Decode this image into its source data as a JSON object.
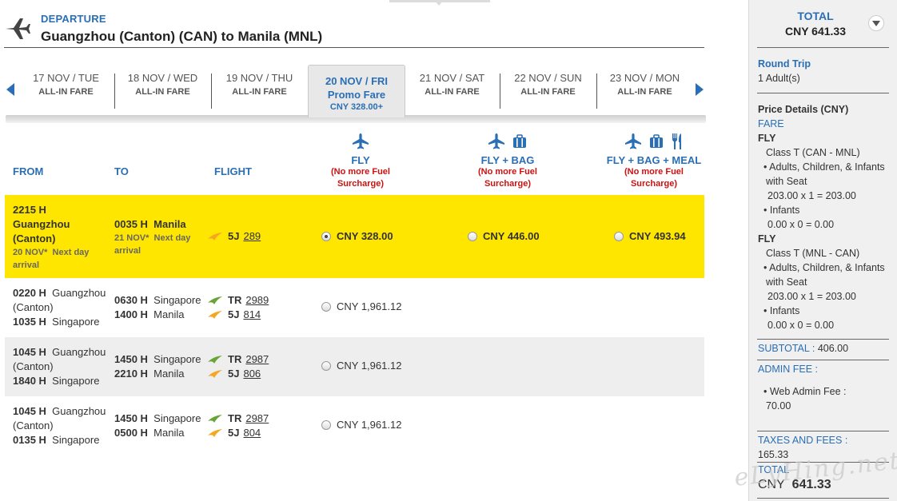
{
  "departure": {
    "label": "DEPARTURE",
    "route": "Guangzhou (Canton)  (CAN) to  Manila  (MNL)"
  },
  "dates": [
    {
      "date": "17 NOV / TUE",
      "fare": "ALL-IN FARE"
    },
    {
      "date": "18 NOV / WED",
      "fare": "ALL-IN FARE"
    },
    {
      "date": "19 NOV / THU",
      "fare": "ALL-IN FARE"
    },
    {
      "date": "20 NOV / FRI",
      "promo": "Promo Fare",
      "price": "CNY 328.00+"
    },
    {
      "date": "21 NOV / SAT",
      "fare": "ALL-IN FARE"
    },
    {
      "date": "22 NOV / SUN",
      "fare": "ALL-IN FARE"
    },
    {
      "date": "23 NOV / MON",
      "fare": "ALL-IN FARE"
    }
  ],
  "columns": {
    "from": "FROM",
    "to": "TO",
    "flight": "FLIGHT"
  },
  "fares": [
    {
      "name": "FLY",
      "note1": "(No more Fuel",
      "note2": "Surcharge)"
    },
    {
      "name": "FLY + BAG",
      "note1": "(No more Fuel",
      "note2": "Surcharge)"
    },
    {
      "name": "FLY + BAG + MEAL",
      "note1": "(No more Fuel",
      "note2": "Surcharge)"
    }
  ],
  "rows": [
    {
      "from": {
        "time": "2215 H",
        "place1": "Guangzhou",
        "place2": "(Canton)",
        "note": "20 NOV*",
        "note2": "Next day",
        "note3": "arrival"
      },
      "to": {
        "time": "0035 H",
        "place": "Manila",
        "note": "21 NOV*",
        "note2": "Next day",
        "note3": "arrival"
      },
      "flights": [
        {
          "code": "5J",
          "num": "289"
        }
      ],
      "prices": [
        "CNY 328.00",
        "CNY 446.00",
        "CNY 493.94"
      ]
    },
    {
      "from": {
        "time1": "0220 H",
        "place1": "Guangzhou",
        "place1b": "(Canton)",
        "time2": "1035 H",
        "place2": "Singapore"
      },
      "to": {
        "time1": "0630 H",
        "place1": "Singapore",
        "time2": "1400 H",
        "place2": "Manila"
      },
      "flights": [
        {
          "code": "TR",
          "num": "2989"
        },
        {
          "code": "5J",
          "num": "814"
        }
      ],
      "prices": [
        "CNY 1,961.12"
      ]
    },
    {
      "from": {
        "time1": "1045 H",
        "place1": "Guangzhou",
        "place1b": "(Canton)",
        "time2": "1840 H",
        "place2": "Singapore"
      },
      "to": {
        "time1": "1450 H",
        "place1": "Singapore",
        "time2": "2210 H",
        "place2": "Manila"
      },
      "flights": [
        {
          "code": "TR",
          "num": "2987"
        },
        {
          "code": "5J",
          "num": "806"
        }
      ],
      "prices": [
        "CNY 1,961.12"
      ]
    },
    {
      "from": {
        "time1": "1045 H",
        "place1": "Guangzhou",
        "place1b": "(Canton)",
        "time2": "0135 H",
        "place2": "Singapore"
      },
      "to": {
        "time1": "1450 H",
        "place1": "Singapore",
        "time2": "0500 H",
        "place2": "Manila"
      },
      "flights": [
        {
          "code": "TR",
          "num": "2987"
        },
        {
          "code": "5J",
          "num": "804"
        }
      ],
      "prices": [
        "CNY 1,961.12"
      ]
    }
  ],
  "sidebar": {
    "title": "TOTAL",
    "total": "CNY  641.33",
    "trip": "Round Trip",
    "pax": "1  Adult(s)",
    "price_details": "Price Details (CNY)",
    "fare_label": "FARE",
    "fly1": "FLY",
    "class1": "Class T (CAN - MNL)",
    "adults1a": "• Adults, Children, & Infants",
    "adults1b": "with Seat",
    "calc1": "203.00 x 1 = 203.00",
    "infants1": "• Infants",
    "calc1b": "0.00 x 0 = 0.00",
    "fly2": "FLY",
    "class2": "Class T (MNL - CAN)",
    "adults2a": "• Adults, Children, & Infants",
    "adults2b": "with Seat",
    "calc2": "203.00 x 1 = 203.00",
    "infants2": "• Infants",
    "calc2b": "0.00 x 0 = 0.00",
    "subtotal_label": "SUBTOTAL :",
    "subtotal": "406.00",
    "admin_label": "ADMIN FEE :",
    "web_admin": "• Web Admin Fee :",
    "web_admin_val": "70.00",
    "taxes_label": "TAXES AND FEES :",
    "taxes": "165.33",
    "total_label": "TOTAL",
    "total_cur": "CNY",
    "total_val": "641.33",
    "watermark": "eLyHing.net"
  },
  "colors": {
    "accent": "#2a6fb5",
    "highlight": "#ffe600",
    "alert": "#cc1111"
  }
}
